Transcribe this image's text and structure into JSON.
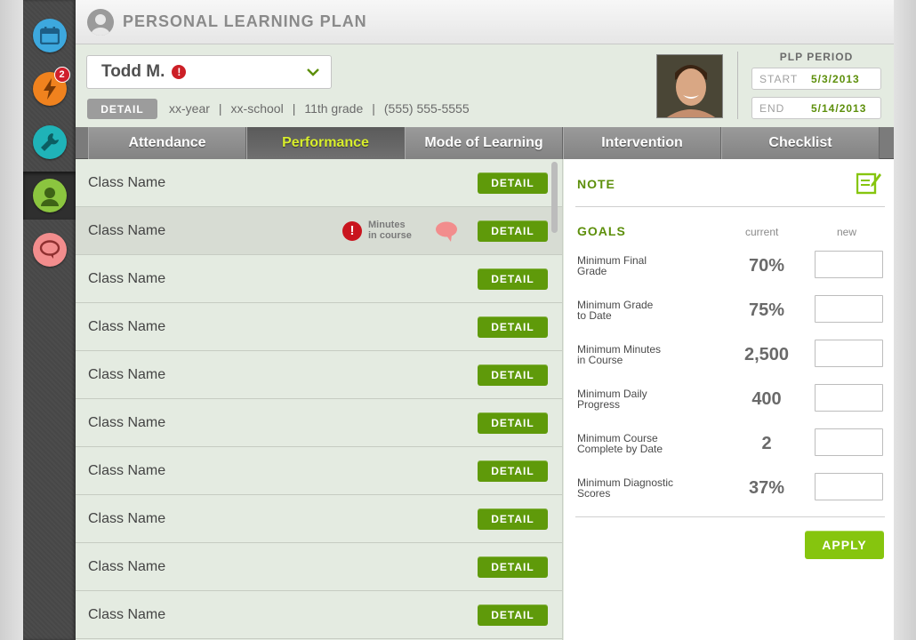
{
  "header": {
    "title": "PERSONAL LEARNING PLAN"
  },
  "sidebar": {
    "items": [
      {
        "name": "calendar",
        "color": "#3da8de",
        "icon": "calendar-icon"
      },
      {
        "name": "alerts",
        "color": "#f0821e",
        "icon": "lightning-icon",
        "badge": "2"
      },
      {
        "name": "tools",
        "color": "#1fb3b8",
        "icon": "wrench-icon"
      },
      {
        "name": "students",
        "color": "#8bc53f",
        "icon": "person-icon",
        "active": true
      },
      {
        "name": "messages",
        "color": "#f28d8d",
        "icon": "chat-bubble-icon"
      }
    ]
  },
  "student": {
    "name": "Todd M.",
    "alert_symbol": "!",
    "detail_label": "DETAIL",
    "year": "xx-year",
    "school": "xx-school",
    "grade": "11th grade",
    "phone": "(555) 555-5555",
    "separator": "|"
  },
  "plp": {
    "title": "PLP PERIOD",
    "start_label": "START",
    "start_value": "5/3/2013",
    "end_label": "END",
    "end_value": "5/14/2013"
  },
  "tabs": [
    {
      "label": "Attendance"
    },
    {
      "label": "Performance"
    },
    {
      "label": "Mode of Learning"
    },
    {
      "label": "Intervention"
    },
    {
      "label": "Checklist"
    }
  ],
  "classes": {
    "detail_label": "DETAIL",
    "alert_symbol": "!",
    "alert_text_line1": "Minutes",
    "alert_text_line2": "in course",
    "rows": [
      {
        "name": "Class Name"
      },
      {
        "name": "Class Name",
        "alert": true
      },
      {
        "name": "Class Name"
      },
      {
        "name": "Class Name"
      },
      {
        "name": "Class Name"
      },
      {
        "name": "Class Name"
      },
      {
        "name": "Class Name"
      },
      {
        "name": "Class Name"
      },
      {
        "name": "Class Name"
      },
      {
        "name": "Class Name"
      }
    ]
  },
  "panel": {
    "note_title": "NOTE",
    "goals_title": "GOALS",
    "col_current": "current",
    "col_new": "new",
    "goals": [
      {
        "line1": "Minimum Final",
        "line2": "Grade",
        "current": "70%"
      },
      {
        "line1": "Minimum Grade",
        "line2": "to Date",
        "current": "75%"
      },
      {
        "line1": "Minimum Minutes",
        "line2": "in Course",
        "current": "2,500"
      },
      {
        "line1": "Minimum Daily",
        "line2": "Progress",
        "current": "400"
      },
      {
        "line1": "Minimum Course",
        "line2": "Complete by Date",
        "current": "2"
      },
      {
        "line1": "Minimum Diagnostic",
        "line2": "Scores",
        "current": "37%"
      }
    ],
    "apply_label": "APPLY"
  }
}
